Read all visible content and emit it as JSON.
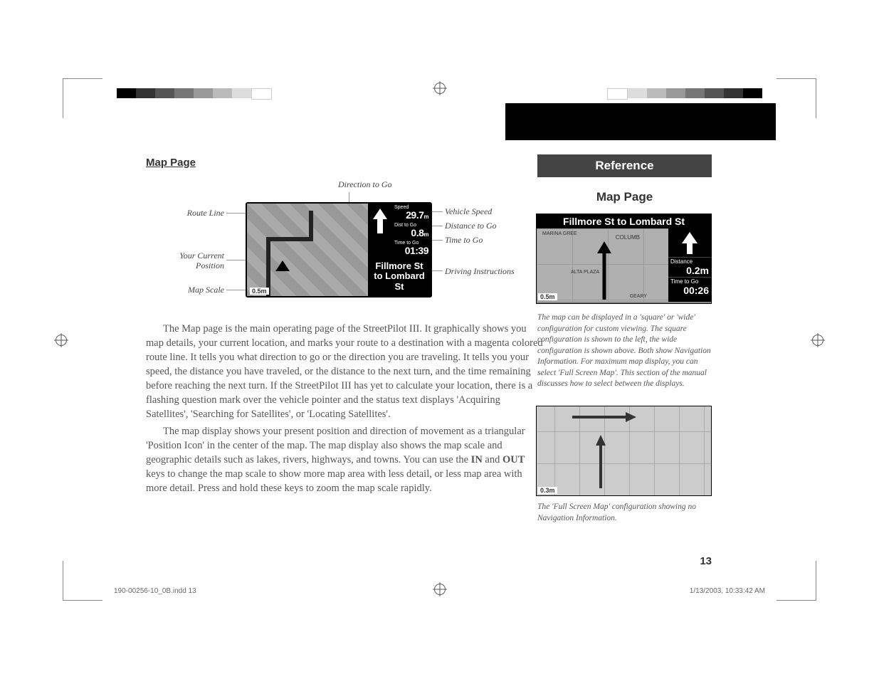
{
  "section_title": "Map Page",
  "diagram": {
    "top_label": "Direction to Go",
    "left_labels": {
      "route": "Route Line",
      "position1": "Your Current",
      "position2": "Position",
      "scale": "Map Scale"
    },
    "right_labels": {
      "speed": "Vehicle Speed",
      "dist": "Distance to Go",
      "time": "Time to Go",
      "instr": "Driving Instructions"
    },
    "screen": {
      "speed_label": "Speed",
      "speed_val": "29.7",
      "speed_unit": "m",
      "dist_label": "Dist to Go",
      "dist_val": "0.8",
      "dist_unit": "m",
      "time_label": "Time to Go",
      "time_val": "01:39",
      "instr": "Fillmore St to Lombard St",
      "scale": "0.5m"
    }
  },
  "body": {
    "p1": "The Map page is the main operating page of the StreetPilot III.  It graphically shows you map details, your current location, and marks your route to a destination with a magenta colored route line. It tells you what direction to go or the direction you are traveling.  It tells you your speed, the distance you have traveled, or the distance to the next turn, and the time remaining before reaching the next turn.  If the StreetPilot III has yet to calculate your location, there is a flashing question mark over the vehicle pointer and the status text displays 'Acquiring Satellites', 'Searching for Satellites', or 'Locating Satellites'.",
    "p2a": "The map display shows your present position and direction of movement as a triangular 'Position Icon' in the center of the map.  The map display also shows the map scale and geographic details such as lakes, rivers, highways, and towns.  You can use the ",
    "p2_in": "IN",
    "p2b": " and ",
    "p2_out": "OUT",
    "p2c": " keys to change the map scale to show more map area with less detail, or less map area with more detail.  Press and hold these keys to zoom the map scale rapidly."
  },
  "sidebar": {
    "ref": "Reference",
    "title": "Map Page",
    "screen1": {
      "title": "Fillmore St to Lombard St",
      "dist_label": "Distance",
      "dist_val": "0.2m",
      "time_label": "Time to Go",
      "time_val": "00:26",
      "scale": "0.5m",
      "street1": "COLUMB",
      "street2": "ALTA PLAZA",
      "street3": "GEARY",
      "street4": "MARINA GREE"
    },
    "cap1": "The map can be displayed in a 'square' or 'wide' configuration for custom viewing. The square configuration is shown to the left, the wide configuration is shown above. Both show Navigation Information. For maximum map display, you can select 'Full Screen Map'. This section of the manual discusses how to select between the displays.",
    "screen2": {
      "scale": "0.3m"
    },
    "cap2": "The 'Full Screen Map' configuration showing no Navigation Information."
  },
  "page_num": "13",
  "footer": {
    "left": "190-00256-10_0B.indd   13",
    "right": "1/13/2003, 10:33:42 AM"
  },
  "colorbar": [
    "#000",
    "#444",
    "#666",
    "#888",
    "#aaa",
    "#ccc",
    "#e5e5e5",
    "#fff"
  ]
}
